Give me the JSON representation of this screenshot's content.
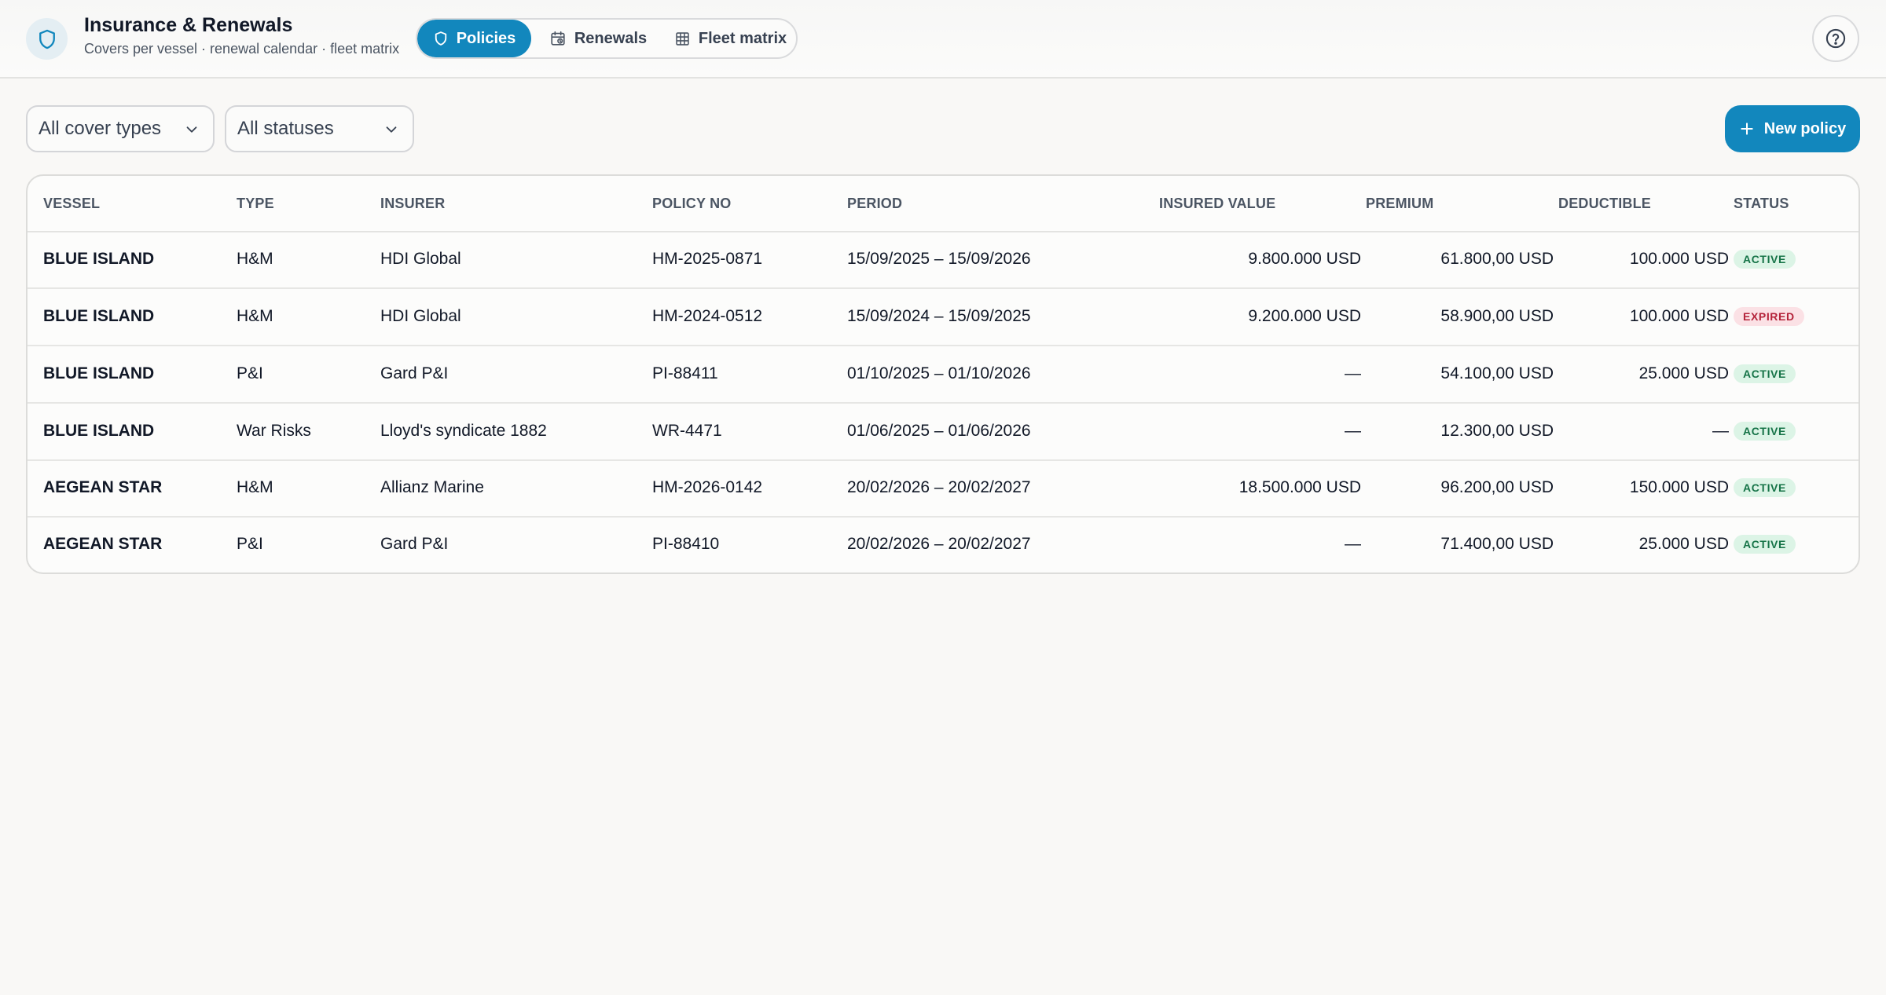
{
  "header": {
    "title": "Insurance & Renewals",
    "subtitle": "Covers per vessel · renewal calendar · fleet matrix",
    "logo_icon": "shield-icon",
    "help_icon": "help-circle-icon"
  },
  "tabs": [
    {
      "label": "Policies",
      "icon": "shield-icon",
      "active": true
    },
    {
      "label": "Renewals",
      "icon": "calendar-icon",
      "active": false
    },
    {
      "label": "Fleet matrix",
      "icon": "grid-icon",
      "active": false
    }
  ],
  "filters": {
    "cover_type": "All cover types",
    "status": "All statuses"
  },
  "actions": {
    "new_policy": "New policy"
  },
  "table": {
    "columns": [
      "VESSEL",
      "TYPE",
      "INSURER",
      "POLICY NO",
      "PERIOD",
      "INSURED VALUE",
      "PREMIUM",
      "DEDUCTIBLE",
      "STATUS"
    ],
    "rows": [
      {
        "vessel": "BLUE ISLAND",
        "type": "H&M",
        "insurer": "HDI Global",
        "policy_no": "HM-2025-0871",
        "period": "15/09/2025 – 15/09/2026",
        "insured_value": "9.800.000 USD",
        "premium": "61.800,00 USD",
        "deductible": "100.000 USD",
        "status": "ACTIVE",
        "status_kind": "active"
      },
      {
        "vessel": "BLUE ISLAND",
        "type": "H&M",
        "insurer": "HDI Global",
        "policy_no": "HM-2024-0512",
        "period": "15/09/2024 – 15/09/2025",
        "insured_value": "9.200.000 USD",
        "premium": "58.900,00 USD",
        "deductible": "100.000 USD",
        "status": "EXPIRED",
        "status_kind": "expired"
      },
      {
        "vessel": "BLUE ISLAND",
        "type": "P&I",
        "insurer": "Gard P&I",
        "policy_no": "PI-88411",
        "period": "01/10/2025 – 01/10/2026",
        "insured_value": "—",
        "premium": "54.100,00 USD",
        "deductible": "25.000 USD",
        "status": "ACTIVE",
        "status_kind": "active"
      },
      {
        "vessel": "BLUE ISLAND",
        "type": "War Risks",
        "insurer": "Lloyd's syndicate 1882",
        "policy_no": "WR-4471",
        "period": "01/06/2025 – 01/06/2026",
        "insured_value": "—",
        "premium": "12.300,00 USD",
        "deductible": "—",
        "status": "ACTIVE",
        "status_kind": "active"
      },
      {
        "vessel": "AEGEAN STAR",
        "type": "H&M",
        "insurer": "Allianz Marine",
        "policy_no": "HM-2026-0142",
        "period": "20/02/2026 – 20/02/2027",
        "insured_value": "18.500.000 USD",
        "premium": "96.200,00 USD",
        "deductible": "150.000 USD",
        "status": "ACTIVE",
        "status_kind": "active"
      },
      {
        "vessel": "AEGEAN STAR",
        "type": "P&I",
        "insurer": "Gard P&I",
        "policy_no": "PI-88410",
        "period": "20/02/2026 – 20/02/2027",
        "insured_value": "—",
        "premium": "71.400,00 USD",
        "deductible": "25.000 USD",
        "status": "ACTIVE",
        "status_kind": "active"
      }
    ]
  },
  "colors": {
    "accent": "#1287bd",
    "active_badge_bg": "#dcf4e6",
    "active_badge_text": "#157347",
    "expired_badge_bg": "#fbe1e5",
    "expired_badge_text": "#b4233a"
  }
}
